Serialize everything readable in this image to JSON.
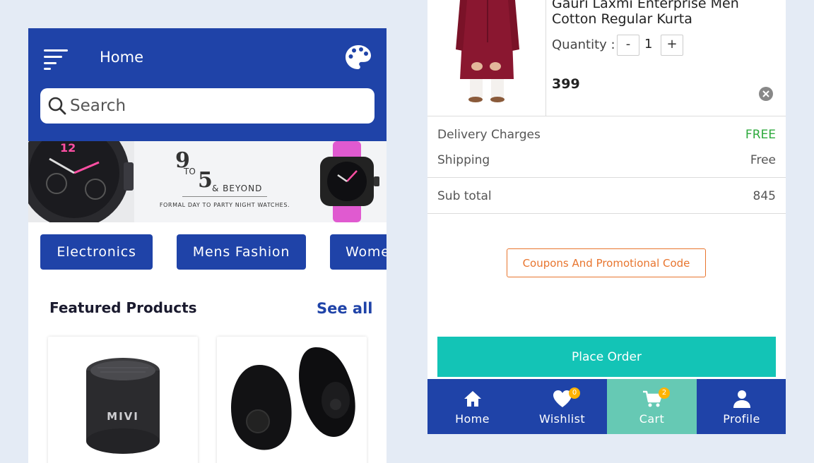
{
  "home": {
    "header": {
      "title": "Home",
      "menu_icon": "sort-menu-icon",
      "theme_icon": "palette-icon"
    },
    "search": {
      "placeholder": "Search"
    },
    "banner": {
      "line_9": "9",
      "line_to": "TO",
      "line_5": "5",
      "line_beyond": "& BEYOND",
      "tagline": "FORMAL DAY TO PARTY NIGHT WATCHES."
    },
    "categories": [
      "Electronics",
      "Mens Fashion",
      "Women"
    ],
    "featured": {
      "title": "Featured Products",
      "see_all": "See all"
    },
    "products": [
      {
        "image": "mivi-speaker",
        "brand_text": "MIVI"
      },
      {
        "image": "bluetooth-earbud"
      }
    ]
  },
  "cart": {
    "item": {
      "name": "Gauri Laxmi Enterprise Men Cotton Regular Kurta",
      "quantity_label": "Quantity :",
      "minus_label": "-",
      "quantity": "1",
      "plus_label": "+",
      "price": "399"
    },
    "summary": {
      "delivery_label": "Delivery Charges",
      "delivery_value": "FREE",
      "shipping_label": "Shipping",
      "shipping_value": "Free",
      "subtotal_label": "Sub total",
      "subtotal_value": "845"
    },
    "coupon_label": "Coupons And Promotional Code",
    "place_order_label": "Place Order",
    "nav": [
      {
        "label": "Home",
        "icon": "home-icon"
      },
      {
        "label": "Wishlist",
        "icon": "heart-icon",
        "badge": "0"
      },
      {
        "label": "Cart",
        "icon": "cart-icon",
        "badge": "2",
        "active": true
      },
      {
        "label": "Profile",
        "icon": "person-icon"
      }
    ]
  },
  "colors": {
    "primary": "#1f43a8",
    "accent_teal": "#13c4b6",
    "active_tab": "#66c9b4",
    "coupon_orange": "#e8752e",
    "free_green": "#2eaa3d",
    "badge": "#ffb300",
    "page_bg": "#e4ebf5"
  }
}
